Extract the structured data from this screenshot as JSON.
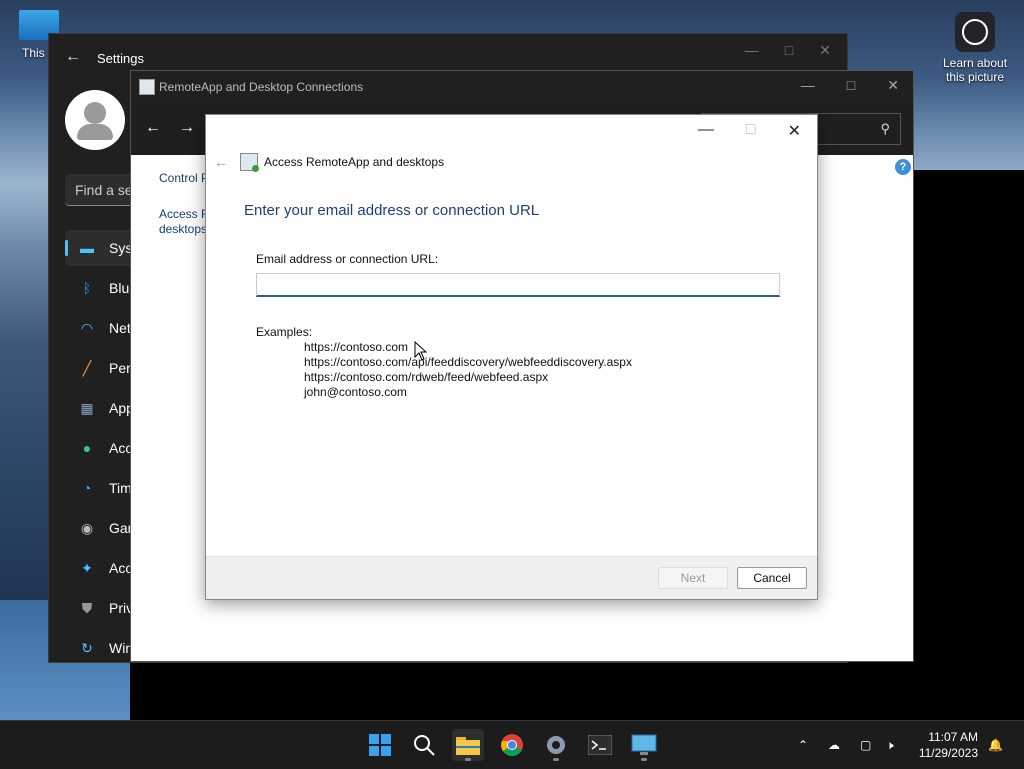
{
  "desktop": {
    "this_pc_label": "This P",
    "learn_label_1": "Learn about",
    "learn_label_2": "this picture"
  },
  "settings": {
    "title": "Settings",
    "search_placeholder": "Find a se",
    "nav": [
      {
        "label": "Syst",
        "icon": "monitor-icon",
        "color": "#4cc2ff"
      },
      {
        "label": "Blue",
        "icon": "bluetooth-icon",
        "color": "#3b8eea"
      },
      {
        "label": "Net",
        "icon": "wifi-icon",
        "color": "#4cc2ff"
      },
      {
        "label": "Pers",
        "icon": "brush-icon",
        "color": "#e8a04c"
      },
      {
        "label": "App",
        "icon": "apps-icon",
        "color": "#8aa0c0"
      },
      {
        "label": "Acc",
        "icon": "person-icon",
        "color": "#3cc2a0"
      },
      {
        "label": "Tim",
        "icon": "clock-globe-icon",
        "color": "#4aa8e8"
      },
      {
        "label": "Gan",
        "icon": "gamepad-icon",
        "color": "#bbbbbb"
      },
      {
        "label": "Acc",
        "icon": "accessibility-icon",
        "color": "#4cc2ff"
      },
      {
        "label": "Priv",
        "icon": "shield-icon",
        "color": "#999999"
      },
      {
        "label": "Win",
        "icon": "update-icon",
        "color": "#4cc2ff"
      }
    ]
  },
  "rdc": {
    "title": "RemoteApp and Desktop Connections",
    "side_control": "Control P",
    "side_access_1": "Access R",
    "side_access_2": "desktops",
    "help": "?"
  },
  "dialog": {
    "title": "Access RemoteApp and desktops",
    "heading": "Enter your email address or connection URL",
    "field_label": "Email address or connection URL:",
    "field_value": "",
    "examples_label": "Examples:",
    "examples": [
      "https://contoso.com",
      "https://contoso.com/api/feeddiscovery/webfeeddiscovery.aspx",
      "https://contoso.com/rdweb/feed/webfeed.aspx",
      "john@contoso.com"
    ],
    "next_label": "Next",
    "cancel_label": "Cancel"
  },
  "taskbar": {
    "time": "11:07 AM",
    "date": "11/29/2023"
  }
}
